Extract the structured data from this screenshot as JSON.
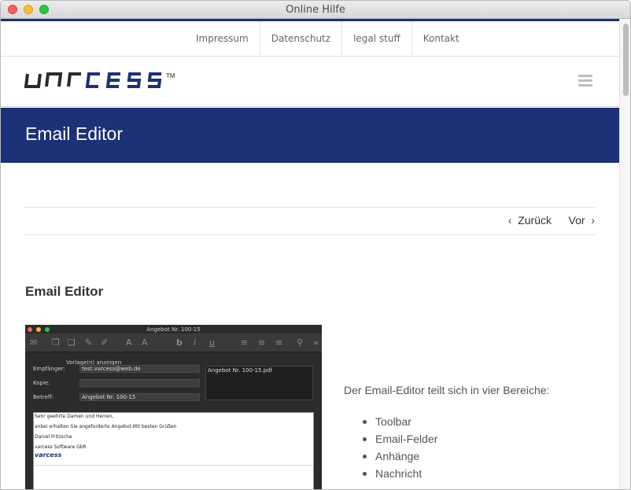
{
  "window": {
    "title": "Online Hilfe"
  },
  "topnav": {
    "items": [
      "Impressum",
      "Datenschutz",
      "legal stuff",
      "Kontakt"
    ]
  },
  "header": {
    "logo_text": "varcess",
    "logo_mark": "TM",
    "menu_icon": "hamburger-icon"
  },
  "page": {
    "title": "Email Editor",
    "prev_label": "Zurück",
    "next_label": "Vor",
    "section_title": "Email Editor",
    "intro": "Der Email-Editor teilt sich in vier Bereiche:",
    "areas": [
      "Toolbar",
      "Email-Felder",
      "Anhänge",
      "Nachricht"
    ]
  },
  "screenshot": {
    "title": "Angebot Nr. 100-15",
    "template_label": "Vorlage(n) anzeigen",
    "to_label": "Empfänger:",
    "to_value": "test.varcess@web.de",
    "cc_label": "Kopie:",
    "cc_value": "",
    "subject_label": "Betreff:",
    "subject_value": "Angebot Nr. 100-15",
    "attachment": "Angebot Nr. 100-15.pdf",
    "message_lines": [
      "Sehr geehrte Damen und Herren,",
      "anbei erhalten Sie angeforderte Angebot.Mit besten Grüßen",
      "Daniel Fritzsche",
      "varcess Software GbR"
    ],
    "signature_logo": "varcess"
  },
  "colors": {
    "brand_blue": "#1b3178",
    "text_gray": "#555555"
  }
}
